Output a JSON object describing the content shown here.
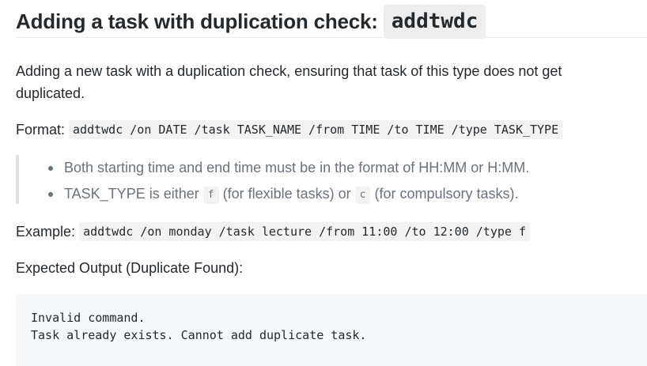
{
  "heading": {
    "text": "Adding a task with duplication check:",
    "code": "addtwdc"
  },
  "intro": "Adding a new task with a duplication check, ensuring that task of this type does not get duplicated.",
  "format": {
    "label": "Format:",
    "code": "addtwdc /on DATE /task TASK_NAME /from TIME /to TIME /type TASK_TYPE"
  },
  "notes": {
    "time_format": "Both starting time and end time must be in the format of HH:MM or H:MM.",
    "type_prefix": "TASK_TYPE is either",
    "type_flexible_code": "f",
    "type_flexible_text": "(for flexible tasks) or",
    "type_compulsory_code": "c",
    "type_compulsory_text": "(for compulsory tasks)."
  },
  "example": {
    "label": "Example:",
    "code": "addtwdc /on monday /task lecture /from 11:00 /to 12:00 /type f"
  },
  "expected_label": "Expected Output (Duplicate Found):",
  "output_lines": [
    "Invalid command.",
    "Task already exists. Cannot add duplicate task."
  ]
}
